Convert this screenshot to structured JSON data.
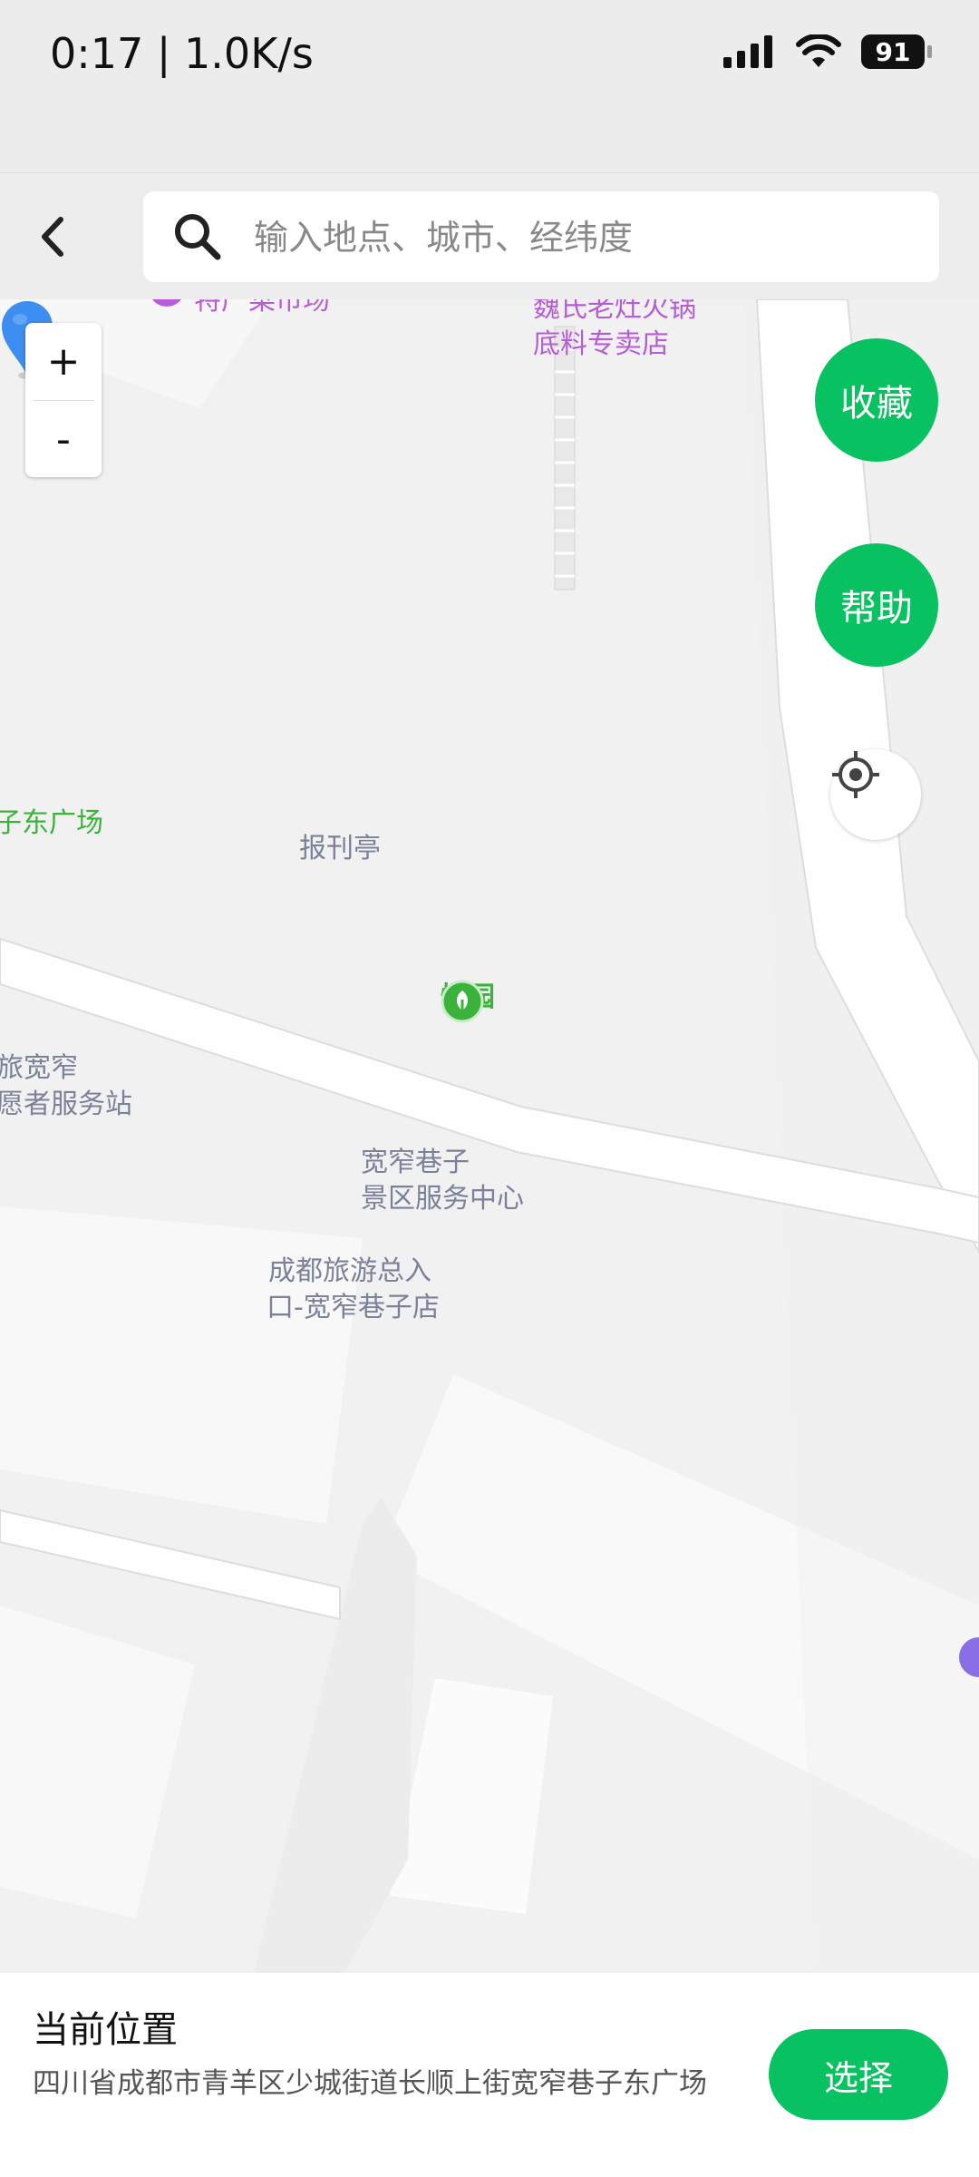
{
  "status_bar": {
    "time_speed": "0:17 | 1.0K/s",
    "battery": "91"
  },
  "top_bar": {
    "search_placeholder": "输入地点、城市、经纬度"
  },
  "map": {
    "zoom_in": "+",
    "zoom_out": "-",
    "favorites_label": "收藏",
    "help_label": "帮助",
    "pois": {
      "market": "特产菜市场",
      "hotpot_line1": "魏氏老灶火锅",
      "hotpot_line2": "底料专卖店",
      "east_square": "子东广场",
      "newsstand": "报刊亭",
      "wuyuan": "悟园",
      "volunteer_line1": "文旅宽窄",
      "volunteer_line2": "志愿者服务站",
      "service_center_line1": "宽窄巷子",
      "service_center_line2": "景区服务中心",
      "tourism_line1": "成都旅游总入",
      "tourism_line2": "口-宽窄巷子店"
    },
    "colors": {
      "poi_purple": "#b65cd6",
      "poi_green": "#3bb33b",
      "poi_gray": "#7a8199",
      "pin_blue": "#3c8ef0",
      "accent_green": "#08c160"
    }
  },
  "bottom_panel": {
    "title": "当前位置",
    "address": "四川省成都市青羊区少城街道长顺上街宽窄巷子东广场",
    "select_label": "选择"
  }
}
